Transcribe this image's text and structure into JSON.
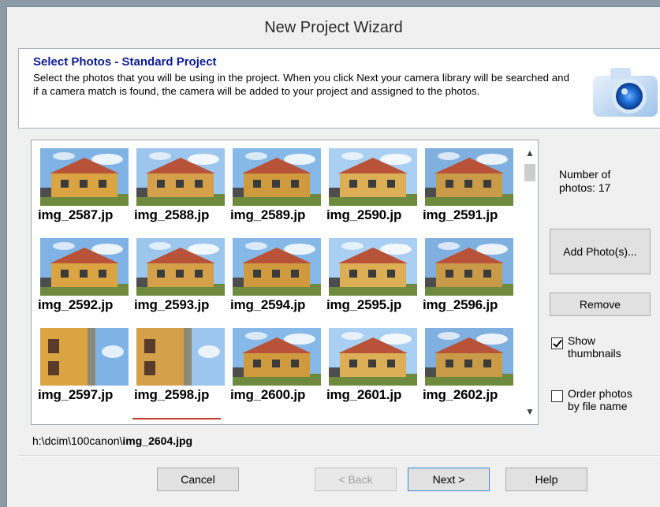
{
  "window": {
    "title": "New Project Wizard"
  },
  "header": {
    "title": "Select Photos - Standard Project",
    "description": "Select the photos that you will be using in the project. When you click Next your camera library will be searched and if a camera match is found, the camera will be added to your project and assigned to the photos.",
    "icon": "camera-icon"
  },
  "photos": [
    "img_2587.jp",
    "img_2588.jp",
    "img_2589.jp",
    "img_2590.jp",
    "img_2591.jp",
    "img_2592.jp",
    "img_2593.jp",
    "img_2594.jp",
    "img_2595.jp",
    "img_2596.jp",
    "img_2597.jp",
    "img_2598.jp",
    "img_2600.jp",
    "img_2601.jp",
    "img_2602.jp"
  ],
  "count": {
    "label": "Number of photos: 17"
  },
  "buttons": {
    "add": "Add Photo(s)...",
    "remove": "Remove",
    "cancel": "Cancel",
    "back": "< Back",
    "next": "Next >",
    "help": "Help"
  },
  "options": {
    "show_thumbnails": {
      "label": "Show thumbnails",
      "checked": true
    },
    "order_by_name": {
      "label": "Order photos by file name",
      "checked": false
    }
  },
  "path": {
    "prefix": "h:\\dcim\\100canon\\",
    "file": "img_2604.jpg"
  },
  "colors": {
    "header_title": "#0b1b8f",
    "primary_border": "#3a86d4"
  }
}
